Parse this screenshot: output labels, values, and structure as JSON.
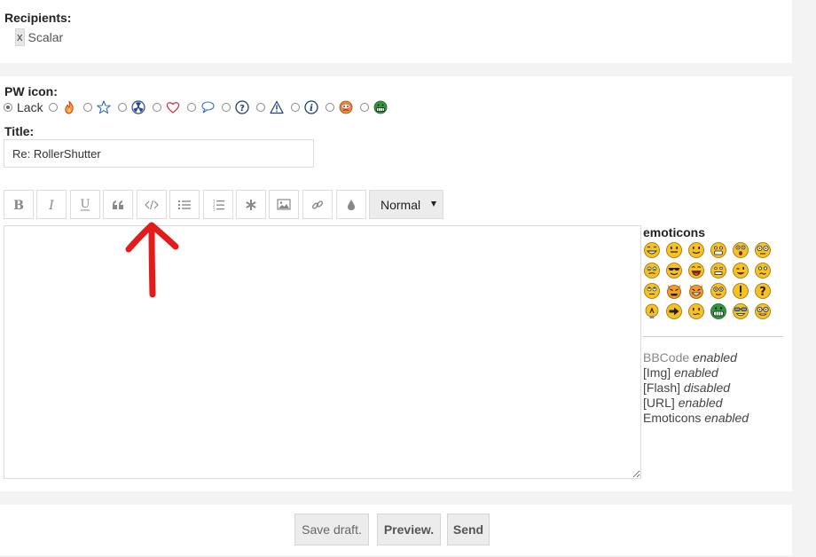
{
  "recipients": {
    "label": "Recipients:",
    "remove_label": "x",
    "items": [
      {
        "name": "Scalar"
      }
    ]
  },
  "pw_icon": {
    "label": "PW icon:",
    "options": [
      {
        "label": "Lack",
        "icon": "none",
        "selected": true
      },
      {
        "icon": "fire-icon"
      },
      {
        "icon": "star-icon"
      },
      {
        "icon": "radioactive-icon"
      },
      {
        "icon": "heart-icon"
      },
      {
        "icon": "speech-bubble-icon"
      },
      {
        "icon": "question-icon"
      },
      {
        "icon": "warning-icon"
      },
      {
        "icon": "info-icon"
      },
      {
        "icon": "mad-face-icon"
      },
      {
        "icon": "grin-face-icon"
      }
    ]
  },
  "title": {
    "label": "Title:",
    "value": "Re: RollerShutter"
  },
  "toolbar": {
    "buttons": [
      "bold-icon",
      "italic-icon",
      "underline-icon",
      "quote-icon",
      "code-icon",
      "bullet-list-icon",
      "numbered-list-icon",
      "asterisk-icon",
      "image-icon",
      "link-icon",
      "color-drop-icon"
    ],
    "size_select": "Normal"
  },
  "message": {
    "value": ""
  },
  "emoticons": {
    "title": "emoticons",
    "items": [
      "laughing",
      "smile",
      "wink-smile",
      "big-grin",
      "surprised",
      "glasses-eyes",
      "blank",
      "cool",
      "tongue",
      "neutral-sweat",
      "wink",
      "confused",
      "rolleyes",
      "evil",
      "twisted-evil",
      "dizzy",
      "exclamation",
      "question",
      "idea",
      "arrow",
      "crazy",
      "green-grin",
      "sunglasses-grin",
      "nerd"
    ]
  },
  "features": [
    {
      "name": "BBCode",
      "status": "enabled"
    },
    {
      "name": "[Img]",
      "status": "enabled"
    },
    {
      "name": "[Flash]",
      "status": "disabled"
    },
    {
      "name": "[URL]",
      "status": "enabled"
    },
    {
      "name": "Emoticons",
      "status": "enabled"
    }
  ],
  "actions": {
    "save_draft": "Save draft.",
    "preview": "Preview.",
    "send": "Send"
  },
  "annotation": {
    "arrow_color": "#e21b1b"
  }
}
